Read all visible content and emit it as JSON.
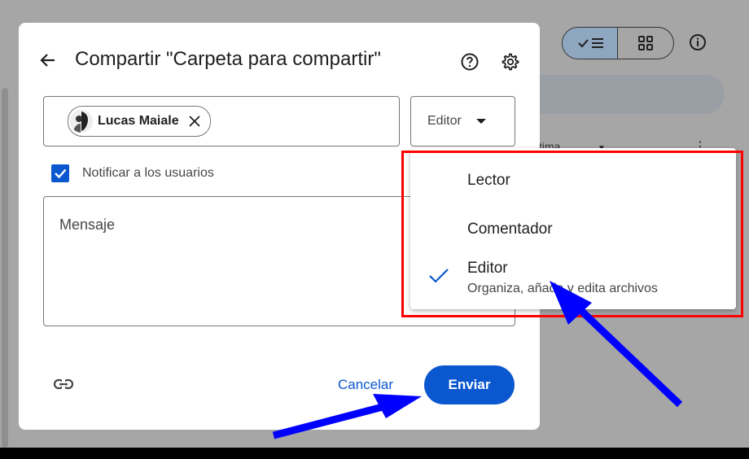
{
  "background": {
    "column_header": "tima",
    "view_toggle": {
      "list_icon": "check-list-icon",
      "grid_icon": "grid-icon"
    },
    "info_icon": "info-icon"
  },
  "dialog": {
    "title": "Compartir \"Carpeta para compartir\"",
    "back_icon": "arrow-back-icon",
    "help_icon": "help-circle-icon",
    "settings_icon": "gear-icon",
    "recipient": {
      "name": "Lucas Maiale"
    },
    "role_select": {
      "value": "Editor"
    },
    "notify": {
      "label": "Notificar a los usuarios",
      "checked": true
    },
    "message": {
      "placeholder": "Mensaje"
    },
    "link_icon": "link-icon",
    "cancel_label": "Cancelar",
    "send_label": "Enviar"
  },
  "role_menu": {
    "items": [
      {
        "label": "Lector",
        "selected": false
      },
      {
        "label": "Comentador",
        "selected": false
      },
      {
        "label": "Editor",
        "description": "Organiza, añade y edita archivos",
        "selected": true
      }
    ]
  },
  "colors": {
    "primary": "#0b57d0",
    "highlight_box": "#ff0000",
    "annotation_arrow": "#0000ff"
  }
}
